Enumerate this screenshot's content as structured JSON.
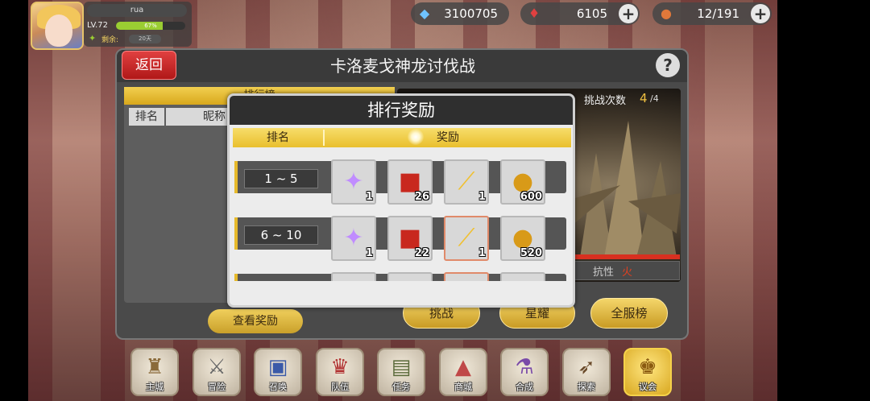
{
  "player": {
    "name": "rua",
    "level": "LV.72",
    "xp_percent": 67,
    "xp_text": "67%",
    "remain_label": "剩余:",
    "remain_value": "20天"
  },
  "resources": [
    {
      "icon": "crystal-icon",
      "value": "3100705",
      "has_plus": false
    },
    {
      "icon": "wing-emblem-icon",
      "value": "6105",
      "has_plus": true
    },
    {
      "icon": "stamina-bread-icon",
      "value": "12/191",
      "has_plus": true
    }
  ],
  "main": {
    "back_label": "返回",
    "title": "卡洛麦戈神龙讨伐战",
    "help_label": "?",
    "rank_tab": "排行榜",
    "rank_columns": [
      "排名",
      "昵称"
    ],
    "view_reward_label": "查看奖励",
    "challenge_label": "挑战次数",
    "challenge_count": "4",
    "challenge_max": "/4",
    "resist_label": "抗性",
    "resist_value": "火",
    "actions": [
      "挑战",
      "星耀",
      "全服榜"
    ]
  },
  "popup": {
    "title": "排行奖励",
    "col_rank": "排名",
    "col_reward": "奖励",
    "rows": [
      {
        "rank": "1 ~ 5",
        "items": [
          {
            "icon": "rainbow-star-icon",
            "qty": "1",
            "hl": false
          },
          {
            "icon": "red-treasure-chest-icon",
            "qty": "26",
            "hl": false
          },
          {
            "icon": "potion-vial-icon",
            "qty": "1",
            "hl": false
          },
          {
            "icon": "golden-helmet-icon",
            "qty": "600",
            "hl": false
          }
        ]
      },
      {
        "rank": "6 ~ 10",
        "items": [
          {
            "icon": "rainbow-star-icon",
            "qty": "1",
            "hl": false
          },
          {
            "icon": "red-treasure-chest-icon",
            "qty": "22",
            "hl": false
          },
          {
            "icon": "potion-vial-icon",
            "qty": "1",
            "hl": true
          },
          {
            "icon": "golden-helmet-icon",
            "qty": "520",
            "hl": false
          }
        ]
      },
      {
        "rank": "",
        "items": [
          {
            "icon": "rainbow-star-icon",
            "qty": "",
            "hl": false
          },
          {
            "icon": "red-treasure-chest-icon",
            "qty": "",
            "hl": false
          },
          {
            "icon": "potion-vial-icon",
            "qty": "",
            "hl": true
          },
          {
            "icon": "golden-helmet-icon",
            "qty": "",
            "hl": false
          }
        ]
      }
    ]
  },
  "nav": [
    {
      "label": "主城",
      "icon": "castle-icon",
      "active": false
    },
    {
      "label": "冒险",
      "icon": "crossed-axes-icon",
      "active": false
    },
    {
      "label": "召唤",
      "icon": "summon-cards-icon",
      "active": false
    },
    {
      "label": "队伍",
      "icon": "winged-crest-icon",
      "active": false
    },
    {
      "label": "任务",
      "icon": "quest-scroll-icon",
      "active": false
    },
    {
      "label": "商城",
      "icon": "shop-tent-icon",
      "active": false
    },
    {
      "label": "合成",
      "icon": "synthesis-flask-icon",
      "active": false
    },
    {
      "label": "探索",
      "icon": "bow-explore-icon",
      "active": false
    },
    {
      "label": "议会",
      "icon": "council-crown-icon",
      "active": true
    }
  ],
  "colors": {
    "gold_accent": "#e6b92a",
    "back_red": "#d02828",
    "resist_fire": "#e04020",
    "challenge_count": "#f0c040"
  }
}
